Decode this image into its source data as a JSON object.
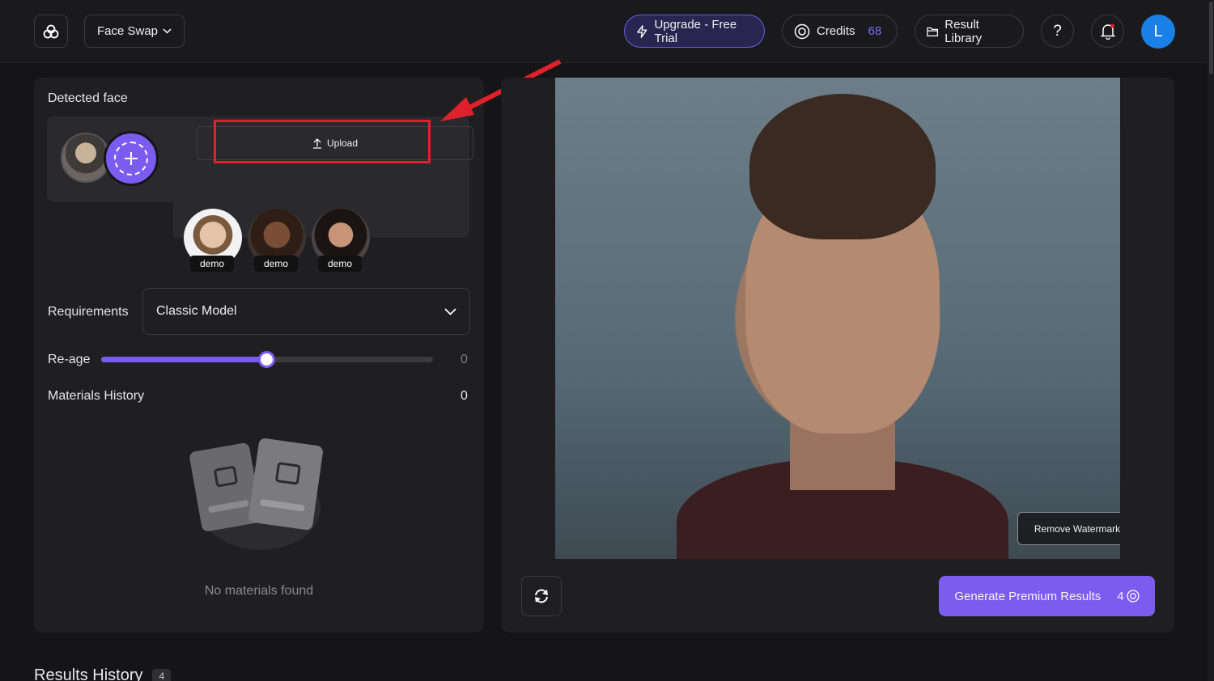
{
  "header": {
    "tool_label": "Face Swap",
    "upgrade_label": "Upgrade - Free Trial",
    "credits_label": "Credits",
    "credits_value": "68",
    "library_label": "Result Library",
    "avatar_letter": "L"
  },
  "left_panel": {
    "detected_face_label": "Detected face",
    "upload_label": "Upload",
    "demos": [
      "demo",
      "demo",
      "demo"
    ],
    "requirements_label": "Requirements",
    "model_value": "Classic Model",
    "reage_label": "Re-age",
    "reage_value": "0",
    "reage_slider_fraction": 0.5,
    "history_label": "Materials History",
    "history_count": "0",
    "empty_text": "No materials found"
  },
  "right_panel": {
    "remove_watermark_label": "Remove Watermark",
    "generate_label": "Generate Premium Results",
    "generate_cost": "4"
  },
  "footer": {
    "results_label": "Results History",
    "results_count": "4"
  },
  "colors": {
    "accent": "#7c5cf0",
    "highlight": "#e0202a",
    "avatar": "#1a7fe6"
  }
}
